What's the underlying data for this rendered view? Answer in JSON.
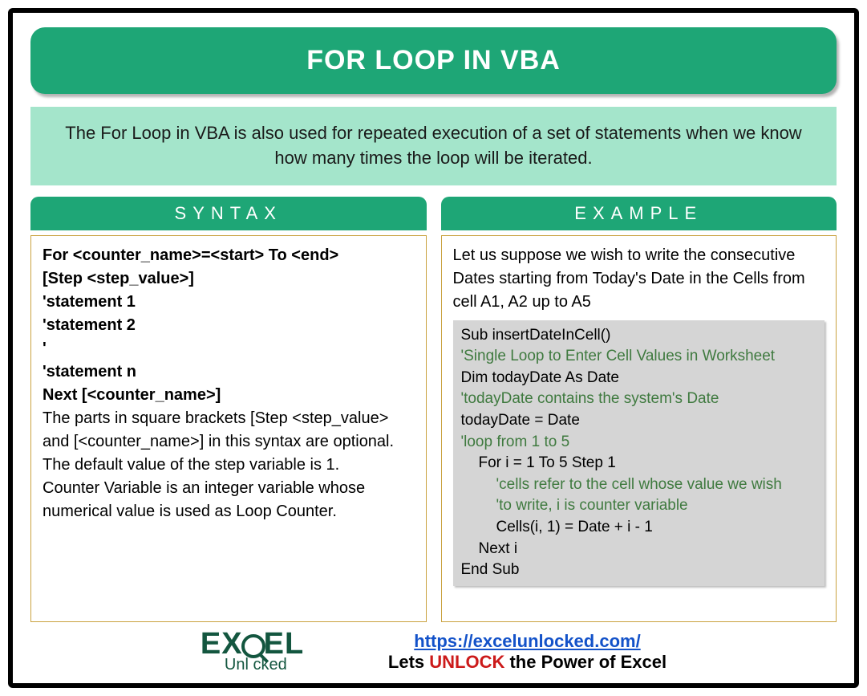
{
  "title": "FOR LOOP IN VBA",
  "description": "The For Loop in VBA is also used for repeated execution of a set of statements when we know how many times the loop will be iterated.",
  "syntax": {
    "header": "SYNTAX",
    "line1": "For <counter_name>=<start> To <end>",
    "line2": "[Step <step_value>]",
    "line3": "'statement 1",
    "line4": "'statement 2",
    "line5": "'",
    "line6": "'statement n",
    "line7": "Next [<counter_name>]",
    "note1": "The parts in square brackets [Step <step_value> and [<counter_name>] in this syntax are optional.",
    "note2": "The default value of the step variable is 1.",
    "note3": "Counter Variable is an integer variable whose numerical value is used as Loop Counter."
  },
  "example": {
    "header": "EXAMPLE",
    "intro": "Let us suppose we wish to write the consecutive Dates starting from Today's Date in the Cells from cell A1, A2 up to A5",
    "code": {
      "l1": "Sub insertDateInCell()",
      "l2": "'Single Loop to Enter Cell Values in Worksheet",
      "l3": "Dim todayDate As Date",
      "l4": "'todayDate contains the system's Date",
      "l5": "todayDate = Date",
      "l6": "'loop from 1 to 5",
      "l7": "For i = 1 To 5 Step 1",
      "l8": "'cells refer to the cell whose value we wish",
      "l9": "'to write, i is counter variable",
      "l10": "Cells(i, 1) = Date + i - 1",
      "l11": "Next i",
      "l12": "End Sub"
    }
  },
  "footer": {
    "logo_main_1": "EX",
    "logo_main_2": "EL",
    "logo_sub": "Unl   cked",
    "url": "https://excelunlocked.com/",
    "tag_pre": "Lets ",
    "tag_unlock": "UNLOCK",
    "tag_post": " the Power of Excel"
  }
}
